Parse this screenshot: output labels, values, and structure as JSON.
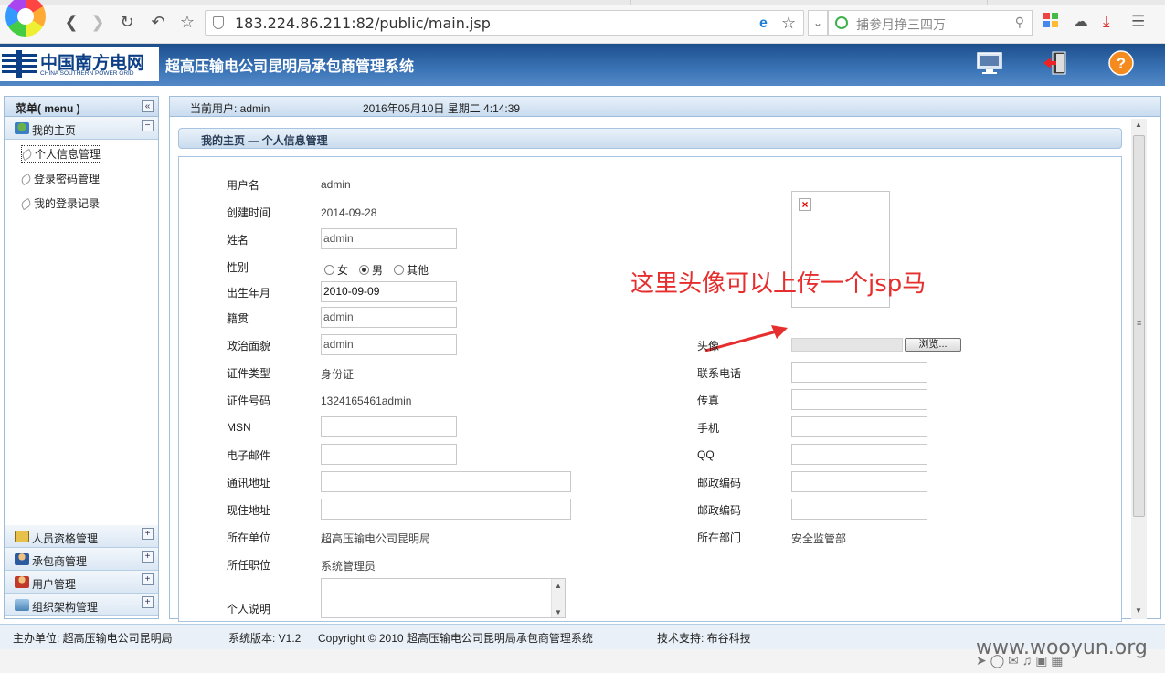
{
  "browser": {
    "url": "183.224.86.211:82/public/main.jsp",
    "search_placeholder": "捕参月挣三四万"
  },
  "app": {
    "brand_cn": "中国南方电网",
    "brand_en": "CHINA SOUTHERN POWER GRID",
    "title": "超高压输电公司昆明局承包商管理系统"
  },
  "sidebar": {
    "header": "菜单( menu )",
    "home_group": "我的主页",
    "items": [
      "个人信息管理",
      "登录密码管理",
      "我的登录记录"
    ],
    "groups": [
      "人员资格管理",
      "承包商管理",
      "用户管理",
      "组织架构管理"
    ]
  },
  "topbar": {
    "user": "当前用户: admin",
    "datetime": "2016年05月10日 星期二 4:14:39"
  },
  "breadcrumb": "我的主页 — 个人信息管理",
  "form": {
    "username_label": "用户名",
    "username": "admin",
    "created_label": "创建时间",
    "created": "2014-09-28",
    "name_label": "姓名",
    "name": "admin",
    "gender_label": "性别",
    "gender_options": [
      "女",
      "男",
      "其他"
    ],
    "gender_selected": "男",
    "birth_label": "出生年月",
    "birth": "2010-09-09",
    "native_label": "籍贯",
    "native": "admin",
    "political_label": "政治面貌",
    "political": "admin",
    "idtype_label": "证件类型",
    "idtype": "身份证",
    "idnum_label": "证件号码",
    "idnum": "1324165461admin",
    "msn_label": "MSN",
    "email_label": "电子邮件",
    "address_label": "通讯地址",
    "current_address_label": "现住地址",
    "unit_label": "所在单位",
    "unit": "超高压输电公司昆明局",
    "position_label": "所任职位",
    "position": "系统管理员",
    "remark_label": "个人说明",
    "avatar_label": "头像",
    "browse_label": "浏览...",
    "phone_label": "联系电话",
    "fax_label": "传真",
    "mobile_label": "手机",
    "qq_label": "QQ",
    "zip1_label": "邮政编码",
    "zip2_label": "邮政编码",
    "dept_label": "所在部门",
    "dept": "安全监管部"
  },
  "annotation": "这里头像可以上传一个jsp马",
  "footer": {
    "host": "主办单位: 超高压输电公司昆明局",
    "version": "系统版本: V1.2",
    "copyright": "Copyright © 2010 超高压输电公司昆明局承包商管理系统",
    "support": "技术支持: 布谷科技"
  },
  "watermark": "www.wooyun.org"
}
